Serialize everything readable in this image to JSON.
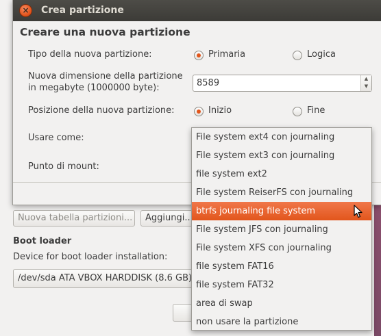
{
  "background": {
    "new_table_button": "Nuova tabella partizioni...",
    "add_button": "Aggiungi...",
    "boot_loader_heading": "Boot loader",
    "boot_device_label": "Device for boot loader installation:",
    "boot_device_value": "/dev/sda ATA VBOX HARDDISK (8.6 GB)"
  },
  "dialog": {
    "title": "Crea partizione",
    "close_glyph": "×",
    "heading": "Creare una nuova partizione",
    "type_label": "Tipo della nuova partizione:",
    "type_options": [
      "Primaria",
      "Logica"
    ],
    "type_selected": "Primaria",
    "size_label_line1": "Nuova dimensione della partizione",
    "size_label_line2": "in megabyte (1000000 byte):",
    "size_value": "8589",
    "position_label": "Posizione della nuova partizione:",
    "position_options": [
      "Inizio",
      "Fine"
    ],
    "position_selected": "Inizio",
    "use_as_label": "Usare come:",
    "mount_label": "Punto di mount:"
  },
  "menu": {
    "items": [
      "File system ext4 con journaling",
      "File system ext3 con journaling",
      "file system ext2",
      "File system ReiserFS con journaling",
      "btrfs journaling file system",
      "File system JFS con journaling",
      "File system XFS con journaling",
      "file system FAT16",
      "file system FAT32",
      "area di swap",
      "non usare la partizione"
    ],
    "selected_index": 4
  },
  "colors": {
    "accent": "#e2561c",
    "titlebar": "#3c3b37",
    "window_bg": "#f2f1f0"
  },
  "icons": {
    "close": "close-icon",
    "pointer": "mouse-pointer-icon",
    "spin": "spin-arrows-icon"
  }
}
